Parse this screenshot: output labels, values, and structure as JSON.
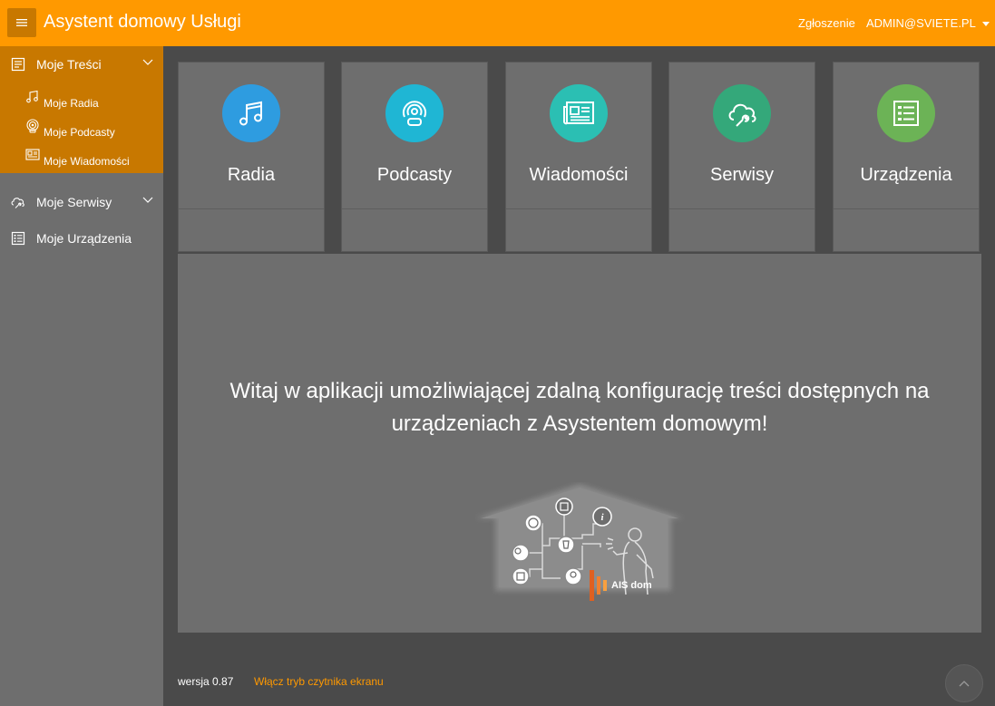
{
  "header": {
    "title": "Asystent domowy Usługi",
    "menu_icon": "hamburger-icon",
    "report_link": "Zgłoszenie",
    "user_menu": "ADMIN@SVIETE.PL",
    "user_menu_icon": "caret-down-icon"
  },
  "sidebar": {
    "sections": [
      {
        "label": "Moje Treści",
        "icon": "content-list-icon",
        "expanded": true,
        "children": [
          {
            "label": "Moje Radia",
            "icon": "music-note-icon"
          },
          {
            "label": "Moje Podcasty",
            "icon": "podcast-icon"
          },
          {
            "label": "Moje Wiadomości",
            "icon": "newspaper-icon"
          }
        ]
      },
      {
        "label": "Moje Serwisy",
        "icon": "cloud-wrench-icon",
        "expanded": false
      },
      {
        "label": "Moje Urządzenia",
        "icon": "device-list-icon"
      }
    ]
  },
  "tiles": [
    {
      "label": "Radia",
      "icon": "music-note-icon",
      "color": "#2e9ce0"
    },
    {
      "label": "Podcasty",
      "icon": "podcast-icon",
      "color": "#1fb6d4"
    },
    {
      "label": "Wiadomości",
      "icon": "newspaper-icon",
      "color": "#2bbfb3"
    },
    {
      "label": "Serwisy",
      "icon": "cloud-wrench-icon",
      "color": "#34a87a"
    },
    {
      "label": "Urządzenia",
      "icon": "device-list-icon",
      "color": "#6cb356"
    }
  ],
  "welcome": {
    "text": "Witaj w aplikacji umożliwiającej zdalną konfigurację treści dostępnych na urządzeniach z Asystentem domowym!",
    "illustration_logo": "AIS dom"
  },
  "footer": {
    "version": "wersja 0.87",
    "screen_reader_link": "Włącz tryb czytnika ekranu",
    "scroll_top_icon": "chevron-up-icon"
  },
  "colors": {
    "accent": "#ff9900",
    "accent_dark": "#c87800",
    "background": "#4a4a4a",
    "panel": "#6e6e6e"
  }
}
